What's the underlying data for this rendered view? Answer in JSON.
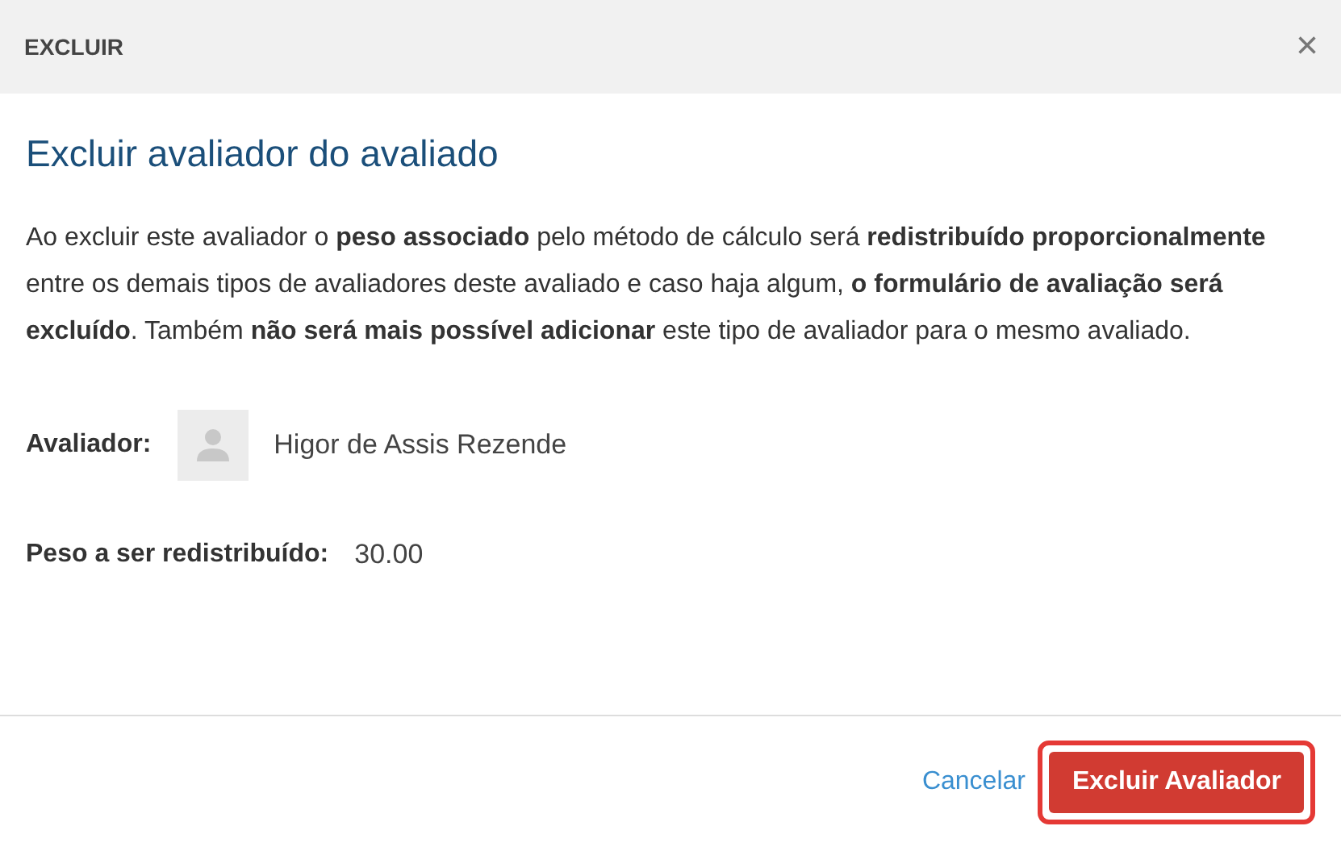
{
  "header": {
    "title": "EXCLUIR",
    "close": "×"
  },
  "heading": "Excluir avaliador do avaliado",
  "message": "Ao excluir este avaliador o **peso associado** pelo método de cálculo será **redistribuído proporcionalmente** entre os demais tipos de avaliadores deste avaliado e caso haja algum, **o formulário de avaliação será excluído**. Também **não será mais possível adicionar** este tipo de avaliador para o mesmo avaliado.",
  "fields": [
    {
      "kind": "person",
      "label": "Avaliador:",
      "value": "Higor de Assis Rezende"
    },
    {
      "kind": "text",
      "label": "Peso a ser redistribuído:",
      "value": "30.00"
    }
  ],
  "footer": {
    "cancel": "Cancelar",
    "confirm": {
      "label": "Excluir Avaliador",
      "highlighted": true
    }
  }
}
